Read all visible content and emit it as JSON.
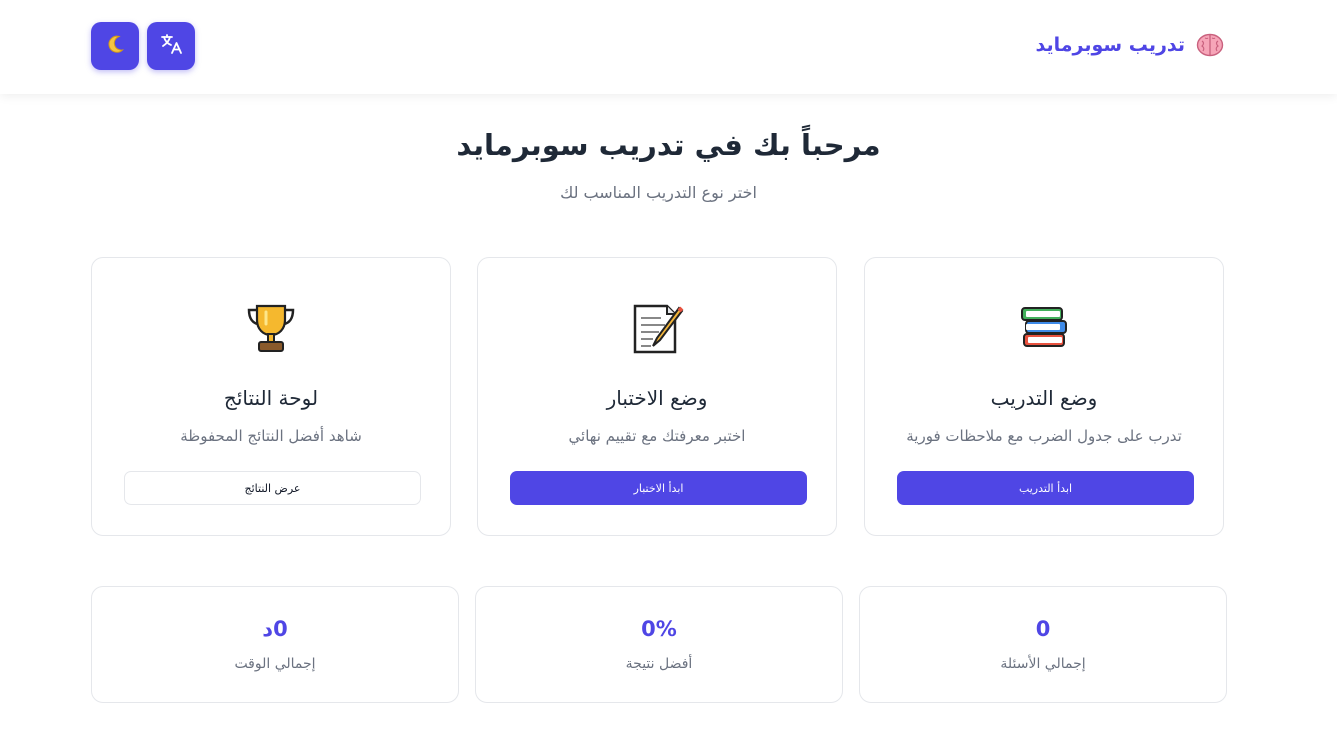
{
  "header": {
    "brand_title": "تدريب سوبرمايد",
    "brand_icon": "brain-icon",
    "translate_icon": "translate-icon",
    "theme_icon": "moon-icon",
    "accent_color": "#4f46e5"
  },
  "hero": {
    "title": "مرحباً بك في تدريب سوبرمايد",
    "subtitle": "اختر نوع التدريب المناسب لك"
  },
  "cards": [
    {
      "icon": "books-icon",
      "title": "وضع التدريب",
      "description": "تدرب على جدول الضرب مع ملاحظات فورية",
      "button_label": "ابدأ التدريب"
    },
    {
      "icon": "memo-icon",
      "title": "وضع الاختبار",
      "description": "اختبر معرفتك مع تقييم نهائي",
      "button_label": "ابدأ الاختبار"
    },
    {
      "icon": "trophy-icon",
      "title": "لوحة النتائج",
      "description": "شاهد أفضل النتائج المحفوظة",
      "button_label": "عرض النتائج"
    }
  ],
  "stats": [
    {
      "value": "0",
      "label": "إجمالي الأسئلة"
    },
    {
      "value": "0%",
      "label": "أفضل نتيجة"
    },
    {
      "value": "0د",
      "label": "إجمالي الوقت"
    }
  ]
}
